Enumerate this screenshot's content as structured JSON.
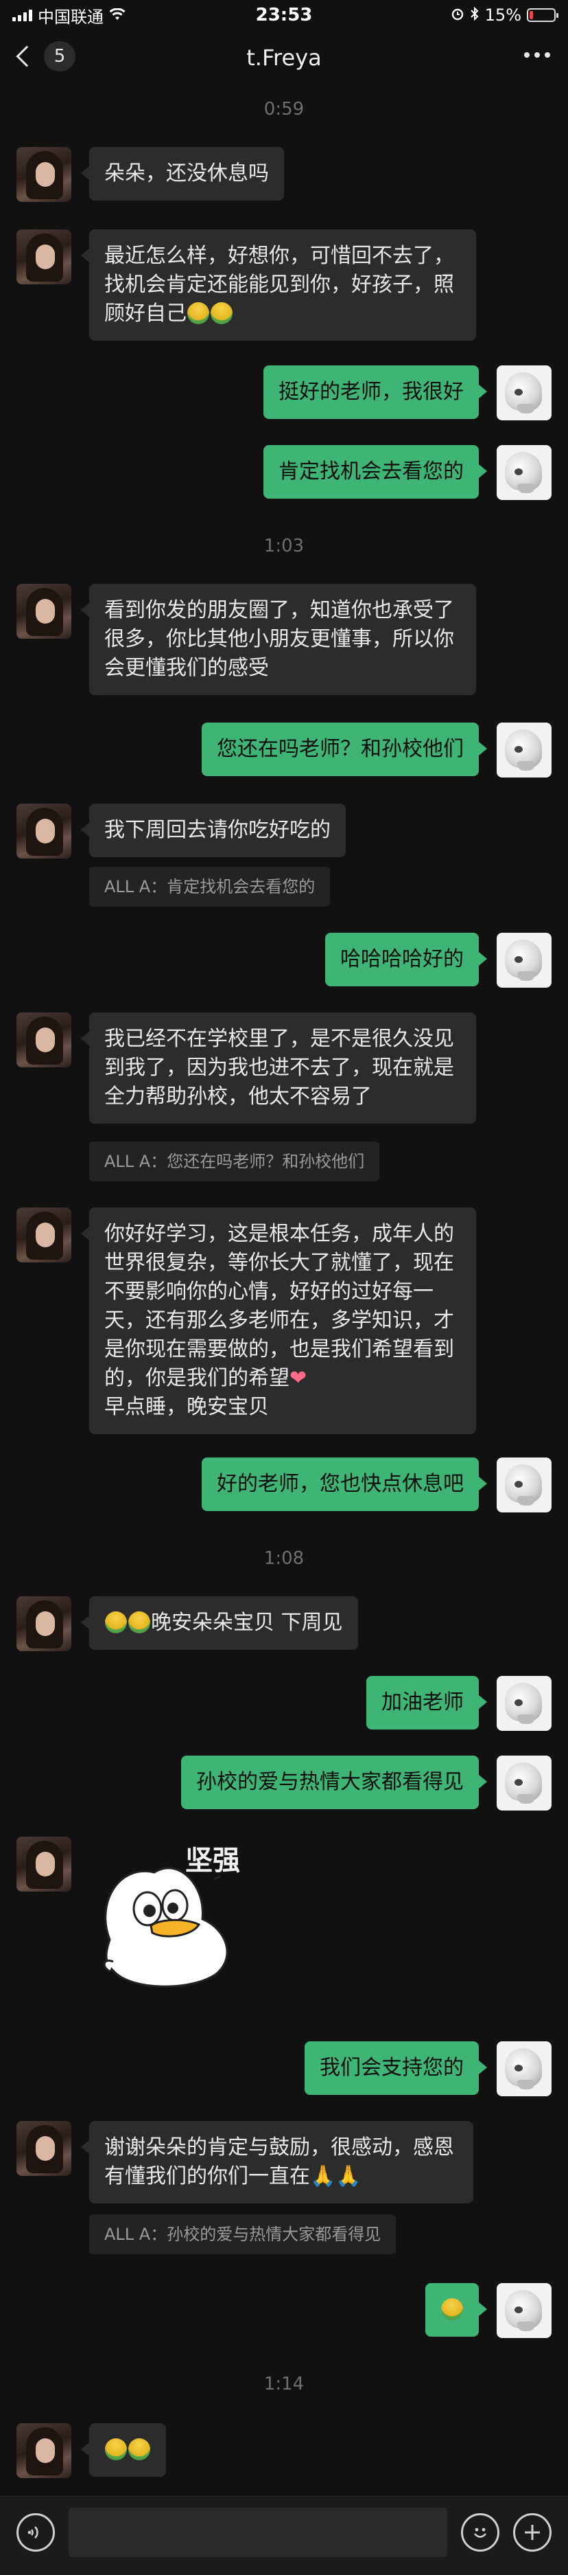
{
  "status_bar": {
    "carrier": "中国联通",
    "time": "23:53",
    "battery": "15%",
    "battery_level": 0.15
  },
  "nav": {
    "unread_count": "5",
    "title": "t.Freya"
  },
  "chat": {
    "t1": "0:59",
    "m1": "朵朵，还没休息吗",
    "m2": "最近怎么样，好想你，可惜回不去了，找机会肯定还能能见到你，好孩子，照顾好自己",
    "m3": "挺好的老师，我很好",
    "m4": "肯定找机会去看您的",
    "t2": "1:03",
    "m5": "看到你发的朋友圈了，知道你也承受了很多，你比其他小朋友更懂事，所以你会更懂我们的感受",
    "m6": "您还在吗老师？和孙校他们",
    "m7": "我下周回去请你吃好吃的",
    "q7": "ALL A：肯定找机会去看您的",
    "m8": "哈哈哈哈好的",
    "m9": "我已经不在学校里了，是不是很久没见到我了，因为我也进不去了，现在就是全力帮助孙校，他太不容易了",
    "q9": "ALL A：您还在吗老师？和孙校他们",
    "m10": "你好好学习，这是根本任务，成年人的世界很复杂，等你长大了就懂了，现在不要影响你的心情，好好的过好每一天，还有那么多老师在，多学知识，才是你现在需要做的，也是我们希望看到的，你是我们的希望",
    "m10b": "早点睡，晚安宝贝",
    "m11": "好的老师，您也快点休息吧",
    "t3": "1:08",
    "m12": "晚安朵朵宝贝 下周见",
    "m13": "加油老师",
    "m14": "孙校的爱与热情大家都看得见",
    "sticker_text": "坚强",
    "m15": "我们会支持您的",
    "m16": "谢谢朵朵的肯定与鼓励，很感动，感恩有懂我们的你们一直在",
    "q16": "ALL A：孙校的爱与热情大家都看得见",
    "t4": "1:14"
  },
  "icons": {
    "voice": "voice-icon",
    "emoji": "emoji-icon",
    "plus": "plus-icon",
    "emoji_green": "person-emoji-icon",
    "heart": "heart-icon"
  },
  "colors": {
    "bubble_self": "#3eb575",
    "bubble_other": "#2c2c2c",
    "background": "#111111"
  }
}
